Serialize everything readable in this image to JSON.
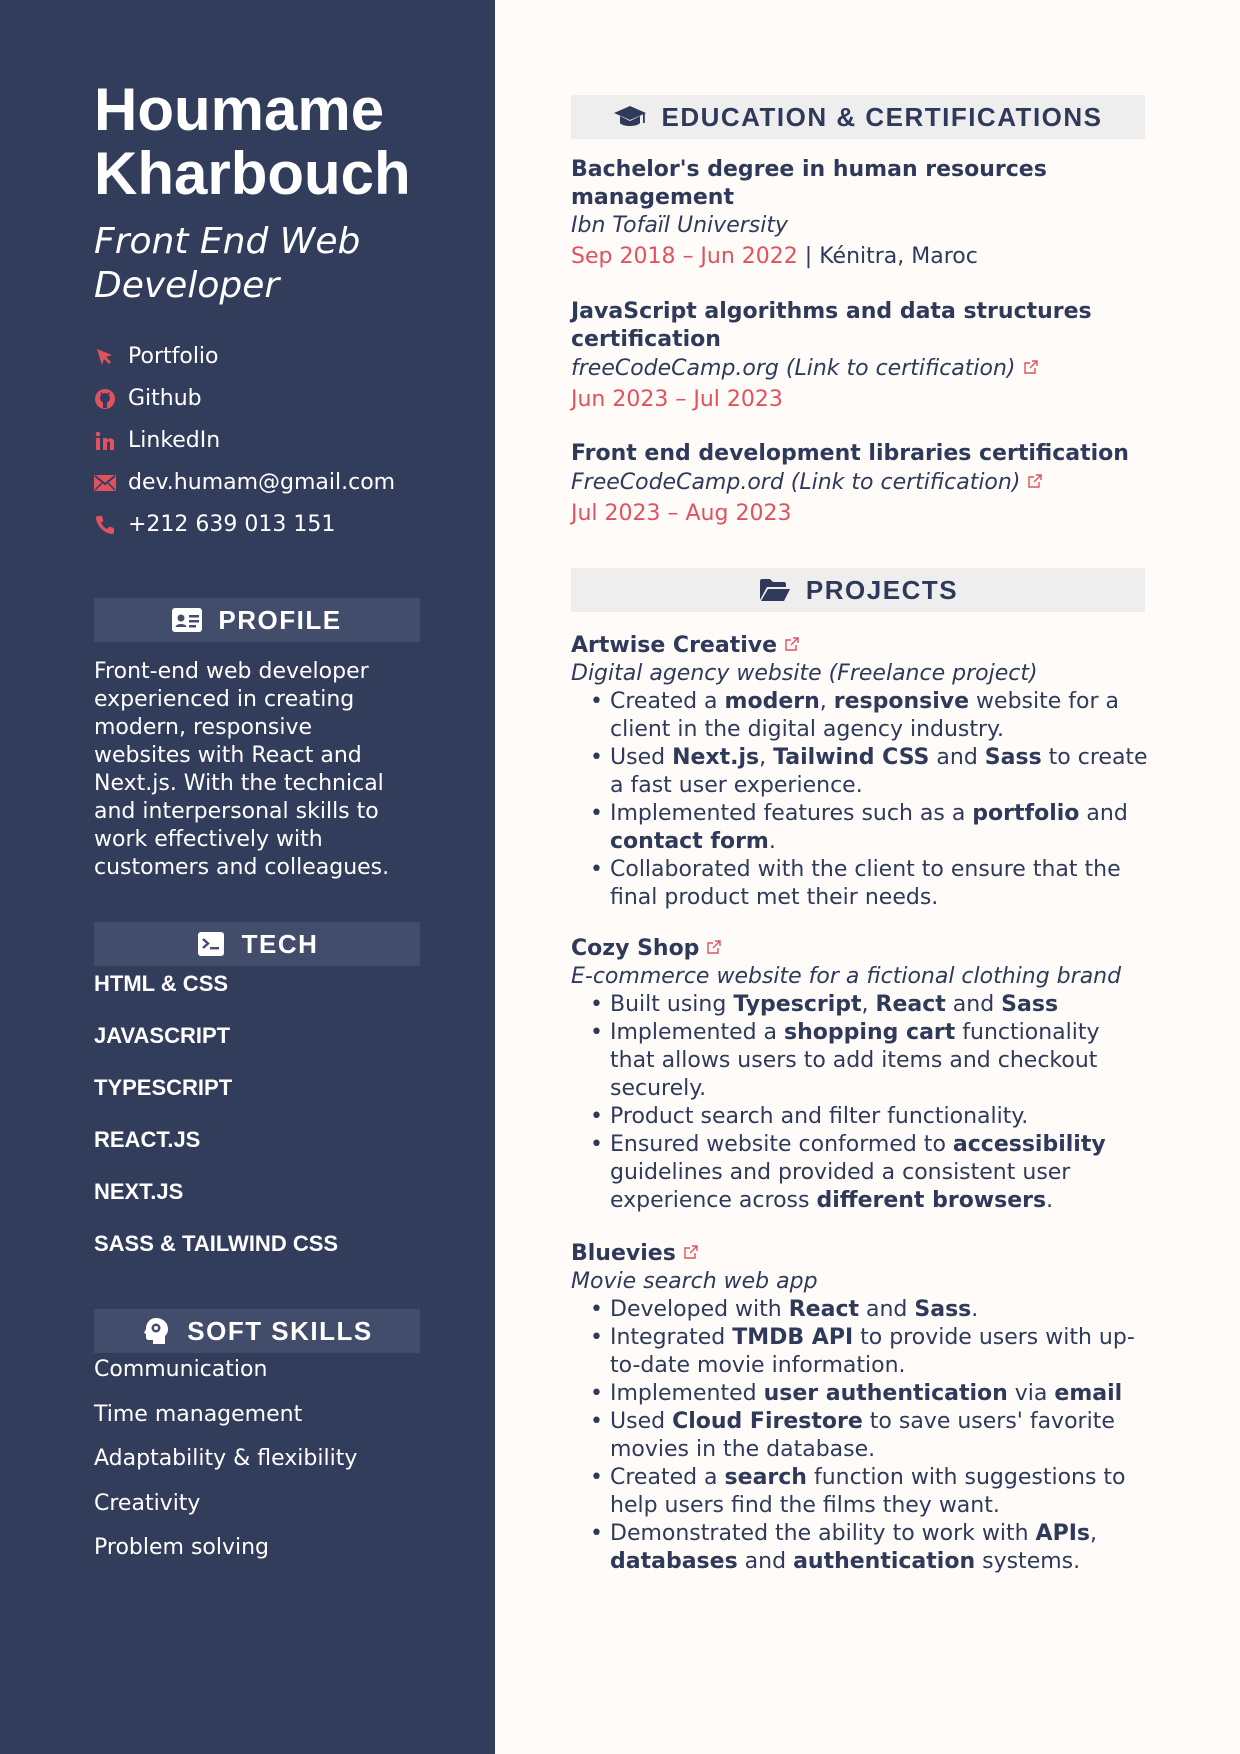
{
  "sidebar": {
    "name_line1": "Houmame",
    "name_line2": "Kharbouch",
    "title_line1": "Front End Web",
    "title_line2": "Developer",
    "contacts": [
      {
        "icon": "cursor-icon",
        "label": "Portfolio"
      },
      {
        "icon": "github-icon",
        "label": "Github"
      },
      {
        "icon": "linkedin-icon",
        "label": "LinkedIn"
      },
      {
        "icon": "email-icon",
        "label": "dev.humam@gmail.com"
      },
      {
        "icon": "phone-icon",
        "label": "+212 639 013 151"
      }
    ],
    "profile": {
      "heading": "PROFILE",
      "text": "Front-end web developer experienced in creating modern, responsive websites with React and Next.js. With the technical and interpersonal skills to work effectively with customers and colleagues."
    },
    "tech": {
      "heading": "TECH",
      "items": [
        "HTML & CSS",
        "JAVASCRIPT",
        "TYPESCRIPT",
        "REACT.JS",
        "NEXT.JS",
        "SASS & TAILWIND CSS"
      ]
    },
    "soft": {
      "heading": "SOFT SKILLS",
      "items": [
        "Communication",
        "Time management",
        "Adaptability & flexibility",
        "Creativity",
        "Problem solving"
      ]
    }
  },
  "education": {
    "heading": "EDUCATION & CERTIFICATIONS",
    "entries": [
      {
        "title_line1": "Bachelor's degree in human resources",
        "title_line2": "management",
        "institution": "Ibn Tofaïl University",
        "dates": "Sep 2018 – Jun 2022",
        "separator": " | ",
        "location": "Kénitra, Maroc"
      },
      {
        "title_line1": "JavaScript algorithms and data structures",
        "title_line2": "certification",
        "institution": "freeCodeCamp.org (Link to certification)",
        "dates": "Jun 2023 – Jul 2023"
      },
      {
        "title_line1": "Front end development libraries certification",
        "institution": "FreeCodeCamp.ord (Link to certification)",
        "dates": "Jul 2023 – Aug 2023"
      }
    ]
  },
  "projects": {
    "heading": "PROJECTS",
    "items": [
      {
        "name": "Artwise Creative",
        "subtitle": "Digital agency website (Freelance project)",
        "bullets": [
          [
            [
              "t",
              "Created a "
            ],
            [
              "b",
              "modern"
            ],
            [
              "t",
              ", "
            ],
            [
              "b",
              "responsive"
            ],
            [
              "t",
              " website for a client in the digital agency industry."
            ]
          ],
          [
            [
              "t",
              "Used "
            ],
            [
              "b",
              "Next.js"
            ],
            [
              "t",
              ", "
            ],
            [
              "b",
              "Tailwind CSS"
            ],
            [
              "t",
              " and "
            ],
            [
              "b",
              "Sass"
            ],
            [
              "t",
              " to create a fast user experience."
            ]
          ],
          [
            [
              "t",
              "Implemented features such as a "
            ],
            [
              "b",
              "portfolio"
            ],
            [
              "t",
              " and "
            ],
            [
              "b",
              "contact form"
            ],
            [
              "t",
              "."
            ]
          ],
          [
            [
              "t",
              "Collaborated with the client to ensure that the final product met their needs."
            ]
          ]
        ]
      },
      {
        "name": "Cozy Shop",
        "subtitle": "E-commerce website for a fictional clothing brand",
        "bullets": [
          [
            [
              "t",
              "Built using "
            ],
            [
              "b",
              "Typescript"
            ],
            [
              "t",
              ", "
            ],
            [
              "b",
              "React"
            ],
            [
              "t",
              " and "
            ],
            [
              "b",
              "Sass"
            ]
          ],
          [
            [
              "t",
              "Implemented a "
            ],
            [
              "b",
              "shopping cart"
            ],
            [
              "t",
              " functionality that allows users to add items and checkout securely."
            ]
          ],
          [
            [
              "t",
              "Product search and filter functionality."
            ]
          ],
          [
            [
              "t",
              "Ensured website conformed to "
            ],
            [
              "b",
              "accessibility"
            ],
            [
              "t",
              " guidelines and provided a consistent user experience across "
            ],
            [
              "b",
              "different browsers"
            ],
            [
              "t",
              "."
            ]
          ]
        ]
      },
      {
        "name": "Bluevies",
        "subtitle": "Movie search web app",
        "bullets": [
          [
            [
              "t",
              "Developed with "
            ],
            [
              "b",
              "React"
            ],
            [
              "t",
              " and "
            ],
            [
              "b",
              "Sass"
            ],
            [
              "t",
              "."
            ]
          ],
          [
            [
              "t",
              "Integrated "
            ],
            [
              "b",
              "TMDB API"
            ],
            [
              "t",
              " to provide users with up-to-date movie information."
            ]
          ],
          [
            [
              "t",
              "Implemented "
            ],
            [
              "b",
              "user authentication"
            ],
            [
              "t",
              " via "
            ],
            [
              "b",
              "email"
            ]
          ],
          [
            [
              "t",
              "Used "
            ],
            [
              "b",
              "Cloud Firestore"
            ],
            [
              "t",
              " to save users' favorite movies in the database."
            ]
          ],
          [
            [
              "t",
              "Created a "
            ],
            [
              "b",
              "search"
            ],
            [
              "t",
              " function with suggestions to help users find the films they want."
            ]
          ],
          [
            [
              "t",
              "Demonstrated the ability to work with "
            ],
            [
              "b",
              "APIs"
            ],
            [
              "t",
              ", "
            ],
            [
              "b",
              "databases"
            ],
            [
              "t",
              " and "
            ],
            [
              "b",
              "authentication"
            ],
            [
              "t",
              " systems."
            ]
          ]
        ]
      }
    ]
  },
  "colors": {
    "sidebar_bg": "#323c5b",
    "accent": "#e0525e",
    "heading_bar_sidebar": "#424c6b",
    "heading_bar_main": "#eeeeee",
    "text_dark": "#2f3a5a"
  }
}
